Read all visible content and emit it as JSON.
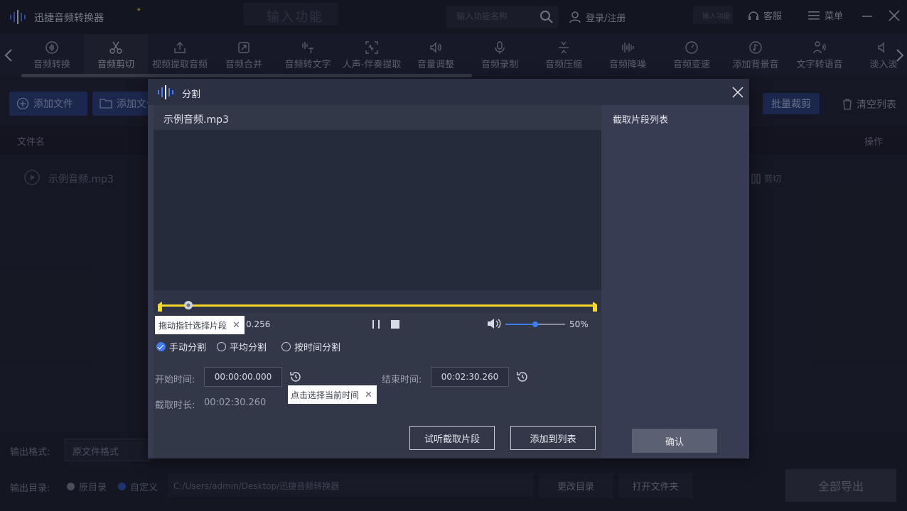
{
  "app": {
    "title": "迅捷音频转换器",
    "tab_input_text": "输入功能",
    "search_placeholder": "输入功能名称",
    "login_label": "登录/注册",
    "mini_input_text": "输入功能",
    "service_label": "客服",
    "menu_label": "菜单"
  },
  "toolbar": {
    "items": [
      {
        "label": "音频转换",
        "icon": "audio-convert-icon"
      },
      {
        "label": "音频剪切",
        "icon": "scissors-icon",
        "active": true
      },
      {
        "label": "视频提取音频",
        "icon": "upload-icon"
      },
      {
        "label": "音频合并",
        "icon": "merge-icon"
      },
      {
        "label": "音频转文字",
        "icon": "audio-to-text-icon"
      },
      {
        "label": "人声-伴奏提取",
        "icon": "vocal-extract-icon"
      },
      {
        "label": "音量调整",
        "icon": "volume-icon"
      },
      {
        "label": "音频录制",
        "icon": "microphone-icon"
      },
      {
        "label": "音频压缩",
        "icon": "compress-icon"
      },
      {
        "label": "音频降噪",
        "icon": "denoise-icon"
      },
      {
        "label": "音频变速",
        "icon": "speed-icon"
      },
      {
        "label": "添加背景音",
        "icon": "bg-music-icon"
      },
      {
        "label": "文字转语音",
        "icon": "text-to-speech-icon"
      },
      {
        "label": "淡入淡",
        "icon": "fade-icon"
      }
    ]
  },
  "main": {
    "add_file_label": "添加文件",
    "add_folder_label": "添加文件",
    "batch_trim_label": "批量裁剪",
    "clear_list_label": "清空列表",
    "col_filename": "文件名",
    "col_action": "操作",
    "file_name": "示例音频.mp3",
    "cut_label": "剪切"
  },
  "bottom": {
    "format_label": "输出格式:",
    "format_value": "原文件格式",
    "dir_label": "输出目录:",
    "radio_original": "原目录",
    "radio_custom": "自定义",
    "dir_path": "C:/Users/admin/Desktop/迅捷音频转换器",
    "change_dir_label": "更改目录",
    "open_folder_label": "打开文件夹",
    "export_all_label": "全部导出"
  },
  "dialog": {
    "title": "分割",
    "file_name": "示例音频.mp3",
    "clip_list_title": "截取片段列表",
    "confirm_label": "确认",
    "time_readout": "0.256",
    "tip_drag": "拖动指针选择片段",
    "volume_percent": "50%",
    "volume_level": 0.5,
    "mode_manual": "手动分割",
    "mode_average": "平均分割",
    "mode_by_time": "按时间分割",
    "start_label": "开始时间:",
    "end_label": "结束时间:",
    "start_value": "00:00:00.000",
    "end_value": "00:02:30.260",
    "tip_current_time": "点击选择当前时间",
    "duration_label": "截取时长:",
    "duration_value": "00:02:30.260",
    "preview_label": "试听截取片段",
    "add_to_list_label": "添加到列表"
  },
  "colors": {
    "accent": "#3d7cf4",
    "trim_line": "#f2d92c",
    "wave_green": "#28c24a",
    "wave_cyan": "#1fb3d6"
  }
}
